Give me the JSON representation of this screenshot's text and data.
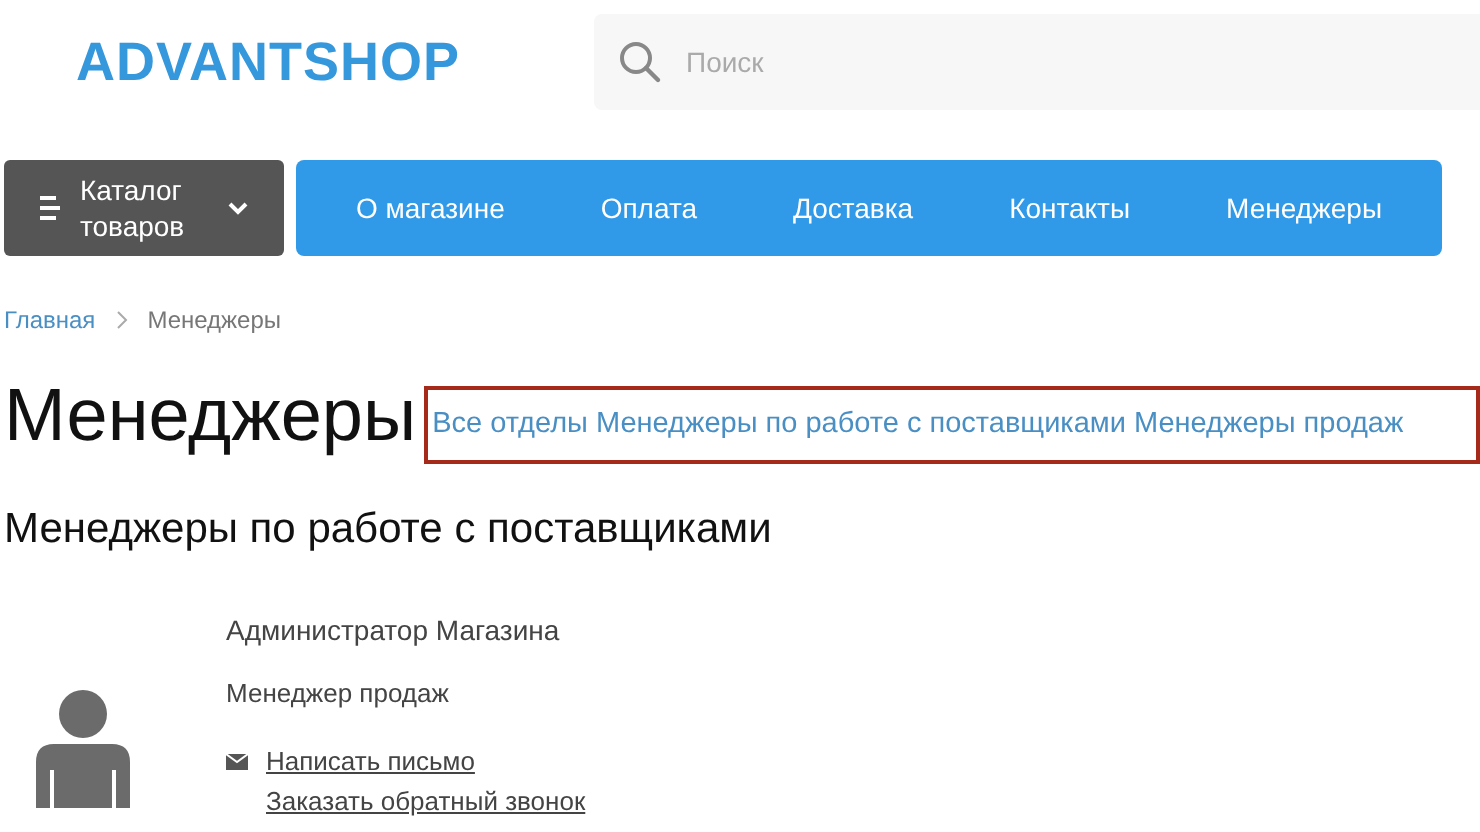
{
  "header": {
    "logo": "ADVANTSHOP",
    "search": {
      "placeholder": "Поиск"
    }
  },
  "catalog_button": "Каталог товаров",
  "nav": [
    {
      "label": "О магазине"
    },
    {
      "label": "Оплата"
    },
    {
      "label": "Доставка"
    },
    {
      "label": "Контакты"
    },
    {
      "label": "Менеджеры"
    }
  ],
  "breadcrumbs": [
    {
      "label": "Главная",
      "link": true
    },
    {
      "label": "Менеджеры",
      "link": false
    }
  ],
  "page_title": "Менеджеры",
  "departments": [
    "Все отделы",
    "Менеджеры по работе с поставщиками",
    "Менеджеры продаж"
  ],
  "section_title": "Менеджеры по работе с поставщиками",
  "managers": [
    {
      "name": "Администратор Магазина",
      "position": "Менеджер продаж",
      "actions": [
        {
          "label": "Написать письмо",
          "kind": "email"
        },
        {
          "label": "Заказать обратный звонок",
          "kind": "call"
        }
      ]
    }
  ]
}
